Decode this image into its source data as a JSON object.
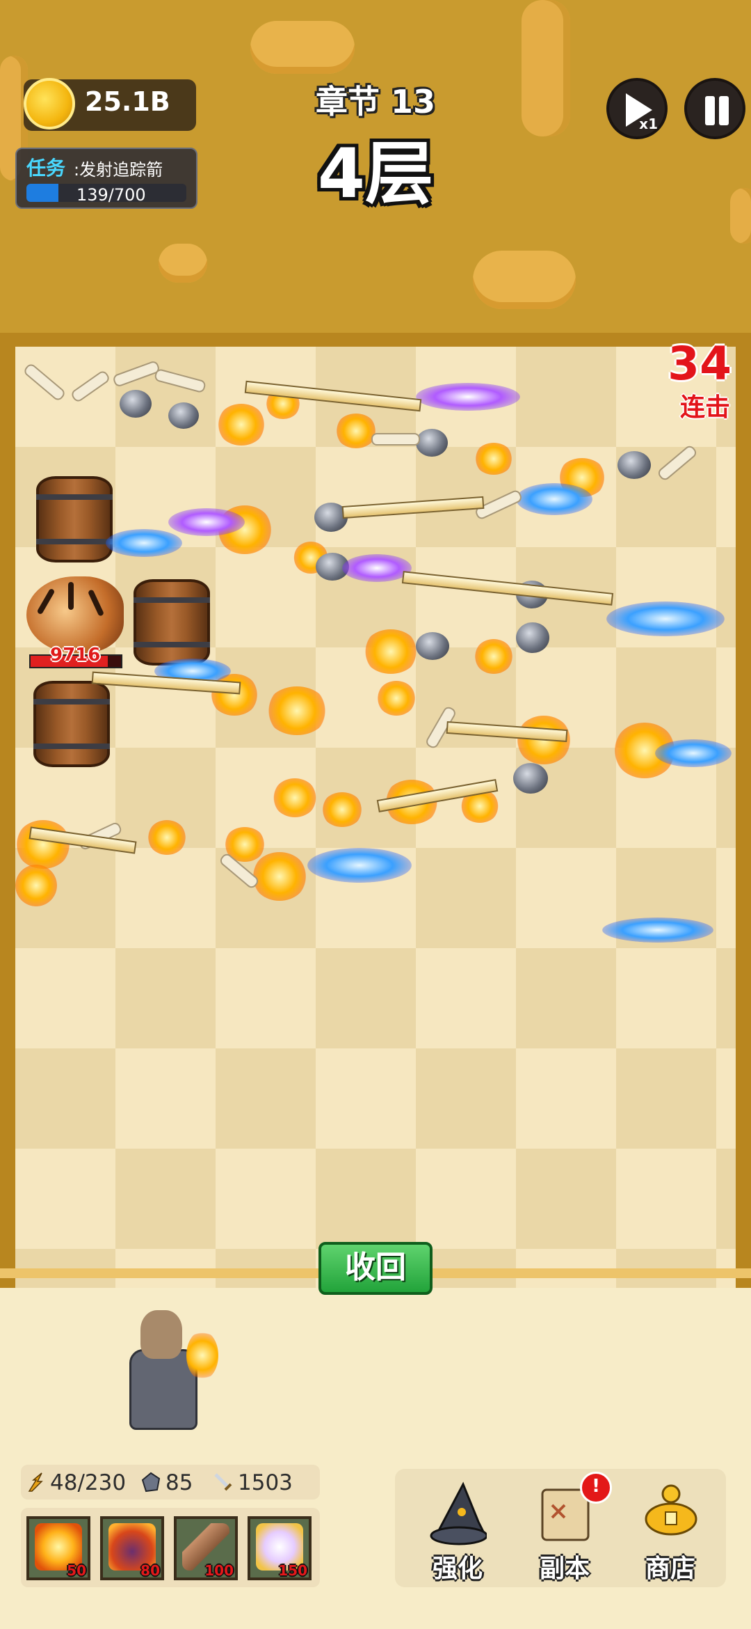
{
  "hud": {
    "coins": "25.1B",
    "task_label": "任务",
    "task_text": ":发射追踪箭",
    "task_progress": "139/700",
    "task_progress_fraction": 0.1986,
    "chapter": "章节 13",
    "floor": "4层",
    "speed": "x1"
  },
  "board": {
    "combo_count": "34",
    "combo_label": "连击",
    "enemy_hp": "9716",
    "enemy_hp_fraction": 0.85
  },
  "actions": {
    "recall": "收回"
  },
  "stats": {
    "energy": "48/230",
    "ore": "85",
    "attack": "1503"
  },
  "skills": [
    {
      "icon": "explosion-icon",
      "cost": "50"
    },
    {
      "icon": "fire-demon-icon",
      "cost": "80"
    },
    {
      "icon": "rock-spikes-icon",
      "cost": "100"
    },
    {
      "icon": "angel-wings-icon",
      "cost": "150"
    }
  ],
  "menu": {
    "upgrade": "强化",
    "dungeon": "副本",
    "shop": "商店",
    "dungeon_alert": "!"
  },
  "colors": {
    "combo": "#e3141a",
    "recall_button": "#22a33a",
    "task_bar": "#1e7de0"
  }
}
